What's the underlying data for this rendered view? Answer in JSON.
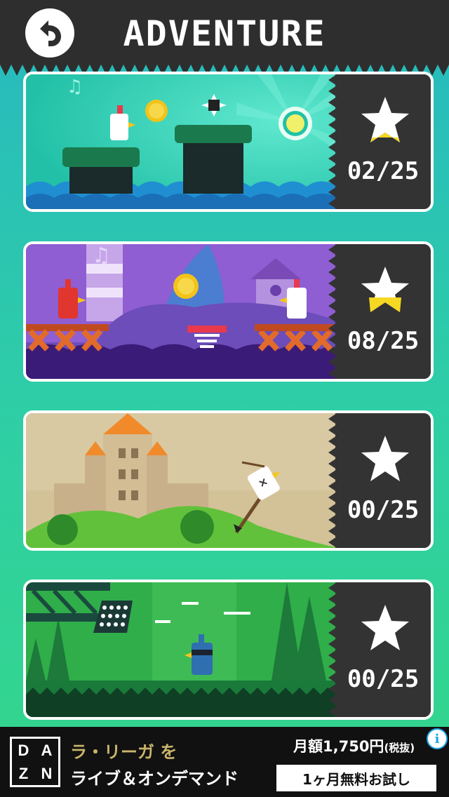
{
  "header": {
    "title": "ADVENTURE",
    "back_icon": "back-arrow-icon"
  },
  "levels": [
    {
      "theme": "sea",
      "stars_label": "02/25",
      "stars_collected": 2,
      "stars_total": 25,
      "star_fill": 0.08
    },
    {
      "theme": "purple-island",
      "stars_label": "08/25",
      "stars_collected": 8,
      "stars_total": 25,
      "star_fill": 0.32
    },
    {
      "theme": "castle",
      "stars_label": "00/25",
      "stars_collected": 0,
      "stars_total": 25,
      "star_fill": 0
    },
    {
      "theme": "forest",
      "stars_label": "00/25",
      "stars_collected": 0,
      "stars_total": 25,
      "star_fill": 0
    }
  ],
  "ad": {
    "brand_letters": [
      "D",
      "A",
      "Z",
      "N"
    ],
    "line1": "ラ・リーガ を",
    "line2": "ライブ＆オンデマンド",
    "price": "月額1,750円",
    "price_note": "(税抜)",
    "cta": "1ヶ月無料お試し",
    "info": "i"
  },
  "colors": {
    "background_top": "#27b9c0",
    "background_bottom": "#34d68a",
    "panel": "#333333",
    "star_fill": "#f5d821"
  }
}
